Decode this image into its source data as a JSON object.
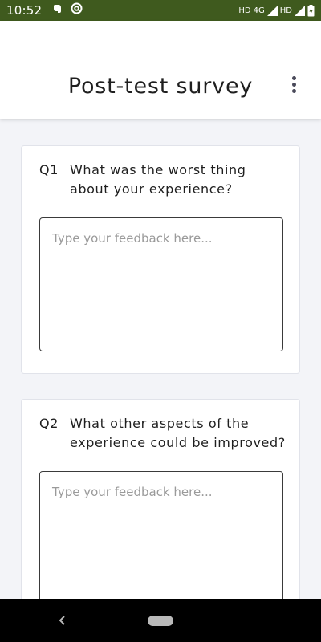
{
  "status_bar": {
    "time": "10:52",
    "network_label_1": "HD",
    "network_type": "4G",
    "network_label_2": "HD",
    "background_color": "#3f5a1e",
    "left_icons": [
      "evernote-icon",
      "at-sign-icon"
    ],
    "right_icons": [
      "signal-icon",
      "signal-icon",
      "battery-charging-icon"
    ]
  },
  "header": {
    "title": "Post-test survey",
    "menu_icon": "more-vertical-icon"
  },
  "questions": [
    {
      "number": "Q1",
      "text": "What was the worst thing about your experience?",
      "placeholder": "Type your feedback here...",
      "value": ""
    },
    {
      "number": "Q2",
      "text": "What other aspects of the experience could be improved?",
      "placeholder": "Type your feedback here...",
      "value": ""
    }
  ],
  "nav_bar": {
    "back_icon": "chevron-left-icon",
    "home_icon": "home-pill-icon"
  }
}
